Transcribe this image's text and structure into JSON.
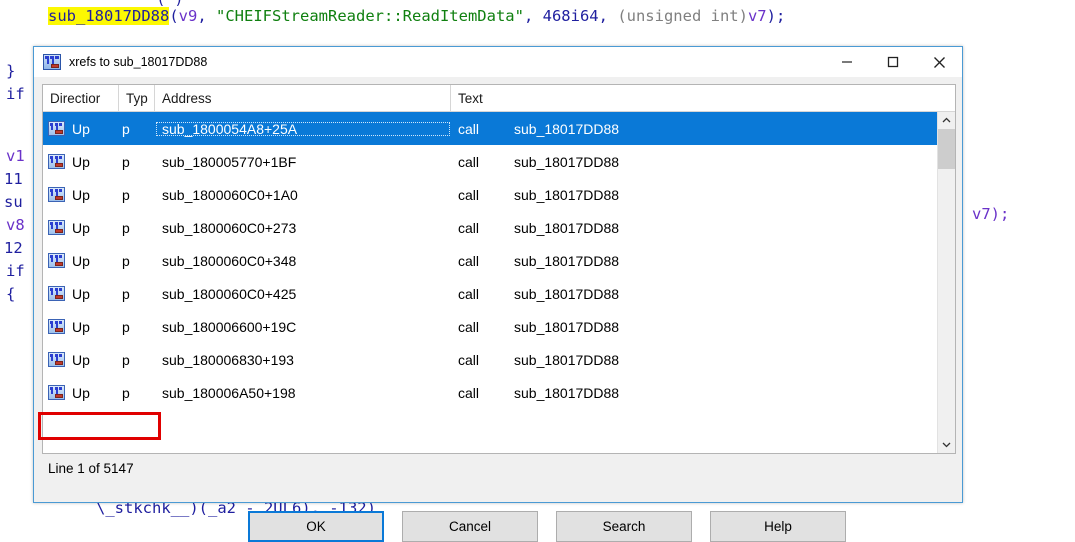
{
  "background": {
    "app": "IDA Pseudocode View",
    "top_line": {
      "fn_highlighted": "sub_18017DD88",
      "open_paren": "(",
      "arg1": "v9",
      "sep1": ", ",
      "arg2": "\"CHEIFStreamReader::ReadItemData\"",
      "sep2": ", ",
      "arg3": "468i64",
      "sep3": ", ",
      "cast": "(unsigned int)",
      "arg4": "v7",
      "tail": ");"
    },
    "partial_top": "`   `_      (`)       '        '",
    "left_fragments": [
      "}",
      "if",
      "v1",
      "11",
      "su",
      "v8",
      "12",
      "if",
      "{"
    ],
    "right_fragments": [
      "v7);"
    ],
    "bottom_fragment": "\\_stkchk__)(_a2 - 2UL6), -132)"
  },
  "dialog": {
    "title": "xrefs to sub_18017DD88",
    "icon": "xref-icon",
    "window_controls": {
      "minimize": "minimize-icon",
      "maximize": "maximize-icon",
      "close": "close-icon"
    },
    "table": {
      "columns": [
        {
          "key": "direction",
          "label": "Directior"
        },
        {
          "key": "type",
          "label": "Typ"
        },
        {
          "key": "address",
          "label": "Address"
        },
        {
          "key": "text",
          "label": "Text"
        }
      ],
      "rows": [
        {
          "icon": "xref-row-icon",
          "direction": "Up",
          "type": "p",
          "address": "sub_1800054A8+25A",
          "call": "call",
          "target": "sub_18017DD88",
          "selected": true
        },
        {
          "icon": "xref-row-icon",
          "direction": "Up",
          "type": "p",
          "address": "sub_180005770+1BF",
          "call": "call",
          "target": "sub_18017DD88",
          "selected": false
        },
        {
          "icon": "xref-row-icon",
          "direction": "Up",
          "type": "p",
          "address": "sub_1800060C0+1A0",
          "call": "call",
          "target": "sub_18017DD88",
          "selected": false
        },
        {
          "icon": "xref-row-icon",
          "direction": "Up",
          "type": "p",
          "address": "sub_1800060C0+273",
          "call": "call",
          "target": "sub_18017DD88",
          "selected": false
        },
        {
          "icon": "xref-row-icon",
          "direction": "Up",
          "type": "p",
          "address": "sub_1800060C0+348",
          "call": "call",
          "target": "sub_18017DD88",
          "selected": false
        },
        {
          "icon": "xref-row-icon",
          "direction": "Up",
          "type": "p",
          "address": "sub_1800060C0+425",
          "call": "call",
          "target": "sub_18017DD88",
          "selected": false
        },
        {
          "icon": "xref-row-icon",
          "direction": "Up",
          "type": "p",
          "address": "sub_180006600+19C",
          "call": "call",
          "target": "sub_18017DD88",
          "selected": false
        },
        {
          "icon": "xref-row-icon",
          "direction": "Up",
          "type": "p",
          "address": "sub_180006830+193",
          "call": "call",
          "target": "sub_18017DD88",
          "selected": false
        },
        {
          "icon": "xref-row-icon",
          "direction": "Up",
          "type": "p",
          "address": "sub_180006A50+198",
          "call": "call",
          "target": "sub_18017DD88",
          "selected": false
        }
      ],
      "scrollbar": {
        "up": "chevron-up-icon",
        "down": "chevron-down-icon",
        "thumb_position": "top"
      }
    },
    "status": "Line 1 of 5147",
    "buttons": [
      {
        "key": "ok",
        "label": "OK",
        "default": true
      },
      {
        "key": "cancel",
        "label": "Cancel",
        "default": false
      },
      {
        "key": "search",
        "label": "Search",
        "default": false
      },
      {
        "key": "help",
        "label": "Help",
        "default": false
      }
    ]
  },
  "annotation": {
    "color": "#e00000",
    "target": "status"
  },
  "colors": {
    "selection": "#0a79d7",
    "highlight": "#fcf802",
    "accent": "#4a9ad4",
    "annotation": "#e00000"
  }
}
